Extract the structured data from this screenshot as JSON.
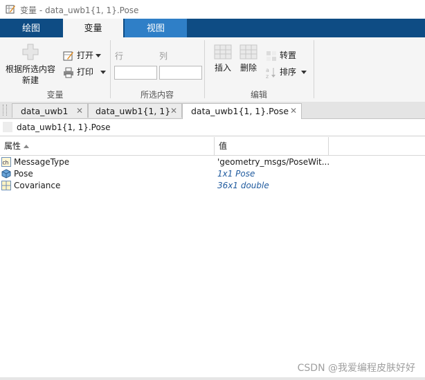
{
  "window": {
    "title": "变量 - data_uwb1{1, 1}.Pose"
  },
  "ribbon": {
    "tabs": [
      {
        "label": "绘图"
      },
      {
        "label": "变量"
      },
      {
        "label": "视图"
      }
    ]
  },
  "toolstrip": {
    "variable_section": {
      "new_from_selection": "根据所选内容",
      "new_from_selection_line2": "新建",
      "open": "打开",
      "print": "打印",
      "label": "变量"
    },
    "selection_section": {
      "row_label": "行",
      "col_label": "列",
      "row_value": "",
      "col_value": "",
      "label": "所选内容"
    },
    "edit_section": {
      "insert": "插入",
      "delete": "删除",
      "transpose": "转置",
      "sort": "排序",
      "label": "编辑"
    }
  },
  "doc_tabs": [
    {
      "label": "data_uwb1"
    },
    {
      "label": "data_uwb1{1, 1}"
    },
    {
      "label": "data_uwb1{1, 1}.Pose"
    }
  ],
  "path": "data_uwb1{1, 1}.Pose",
  "table": {
    "headers": {
      "property": "属性",
      "value": "值"
    },
    "rows": [
      {
        "name": "MessageType",
        "value": "'geometry_msgs/PoseWit...",
        "icon": "char-icon"
      },
      {
        "name": "Pose",
        "value": "1x1 Pose",
        "icon": "object-icon"
      },
      {
        "name": "Covariance",
        "value": "36x1 double",
        "icon": "matrix-icon"
      }
    ]
  },
  "watermark": "CSDN @我爱编程皮肤好好",
  "colors": {
    "ribbon_bg": "#0e4c84",
    "view_tab": "#2f7fc7",
    "value_italic": "#1f5a9e"
  }
}
